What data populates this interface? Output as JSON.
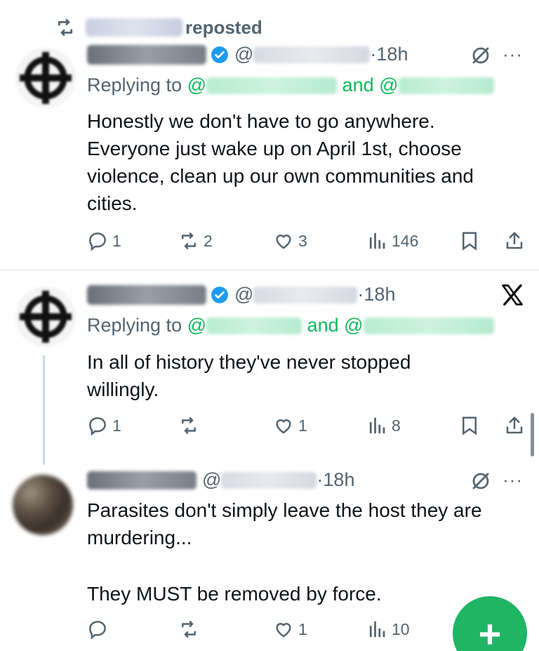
{
  "repost": {
    "icon": "retweet-icon",
    "text": "reposted"
  },
  "tweets": [
    {
      "separator": "@",
      "time": "·18h",
      "replying_label": "Replying to",
      "and_label": "and",
      "at": "@",
      "text": "Honestly we don't have to go anywhere. Everyone just wake up on April 1st, choose violence, clean up our own communities and cities.",
      "stats": {
        "replies": "1",
        "reposts": "2",
        "likes": "3",
        "views": "146"
      }
    },
    {
      "separator": "@",
      "time": "·18h",
      "replying_label": "Replying to",
      "and_label": "and",
      "at": "@",
      "text": "In all of history they've never stopped willingly.",
      "stats": {
        "replies": "1",
        "reposts": "",
        "likes": "1",
        "views": "8"
      }
    },
    {
      "separator": "@",
      "time": "·18h",
      "text_line1": "Parasites don't simply leave the host they are murdering...",
      "text_line2": "They MUST be removed by force.",
      "stats": {
        "replies": "",
        "reposts": "",
        "likes": "1",
        "views": "10"
      }
    }
  ],
  "fab": {
    "label": "+"
  },
  "colors": {
    "accent_green": "#1fb565",
    "mention_green": "#14b85a",
    "verified_blue": "#1d9bf0",
    "muted": "#536471"
  }
}
